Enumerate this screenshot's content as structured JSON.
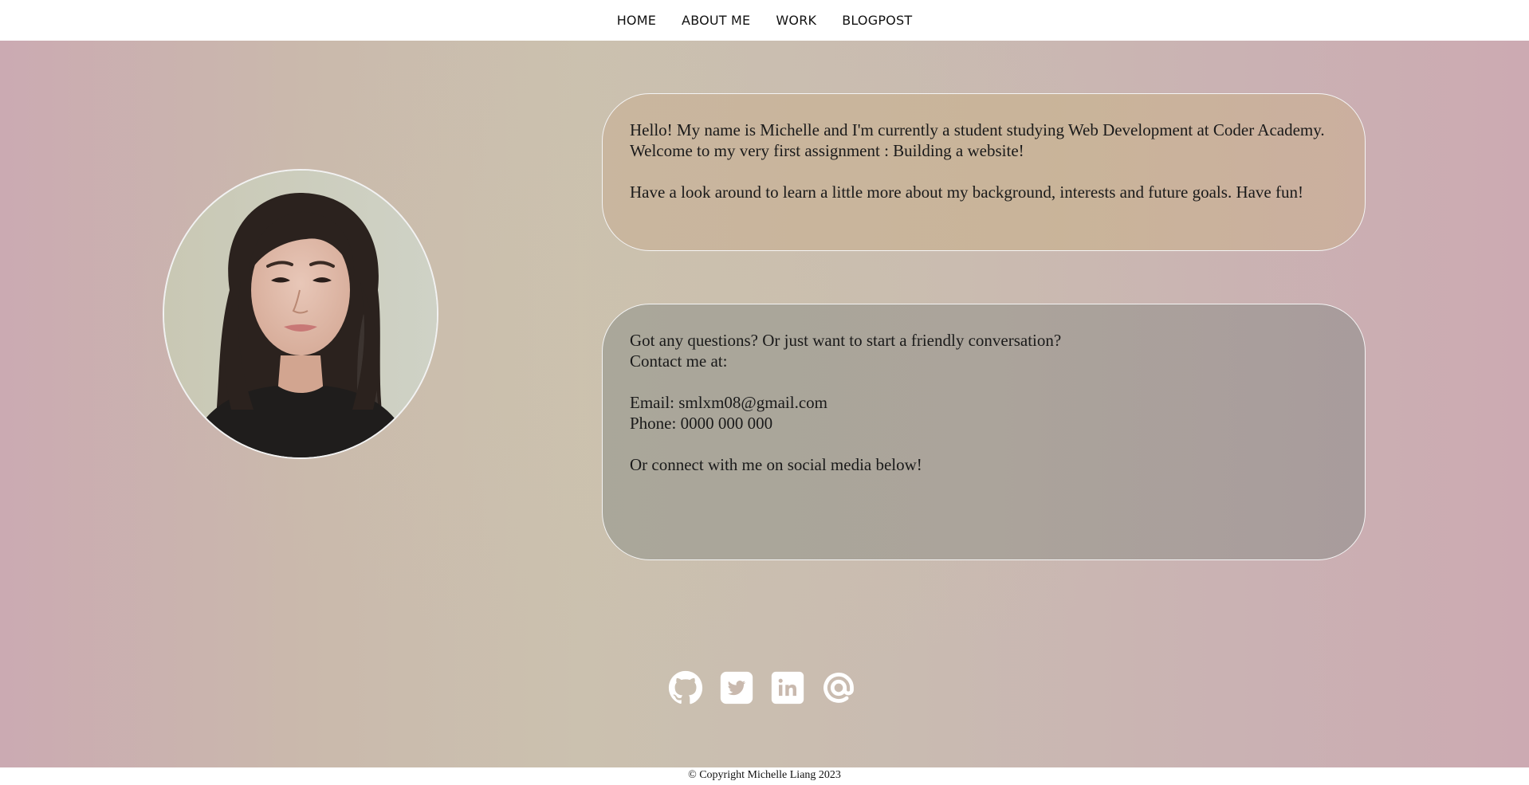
{
  "nav": {
    "items": [
      "HOME",
      "ABOUT ME",
      "WORK",
      "BLOGPOST"
    ]
  },
  "profile": {
    "photo_alt": "Portrait of Michelle Liang"
  },
  "about": {
    "paragraph1": "Hello! My name is Michelle and I'm currently a student studying Web Development at Coder Academy. Welcome to my very first assignment : Building a website!",
    "paragraph2": "Have a look around to learn a little more about my background, interests and future goals. Have fun!"
  },
  "contact": {
    "line1": "Got any questions? Or just want to start a friendly conversation?",
    "line2": "Contact me at:",
    "email": "Email: smlxm08@gmail.com",
    "phone": "Phone: 0000 000 000",
    "social_prompt": "Or connect with me on social media below!"
  },
  "socials": [
    {
      "icon": "github-icon",
      "label": "GitHub"
    },
    {
      "icon": "twitter-icon",
      "label": "Twitter"
    },
    {
      "icon": "linkedin-icon",
      "label": "LinkedIn"
    },
    {
      "icon": "at-icon",
      "label": "Email"
    }
  ],
  "footer": {
    "copyright": "© Copyright Michelle Liang 2023"
  },
  "colors": {
    "icon": "#ffffff",
    "background_pink": "#cbaab2",
    "background_beige": "#cbc1af"
  }
}
